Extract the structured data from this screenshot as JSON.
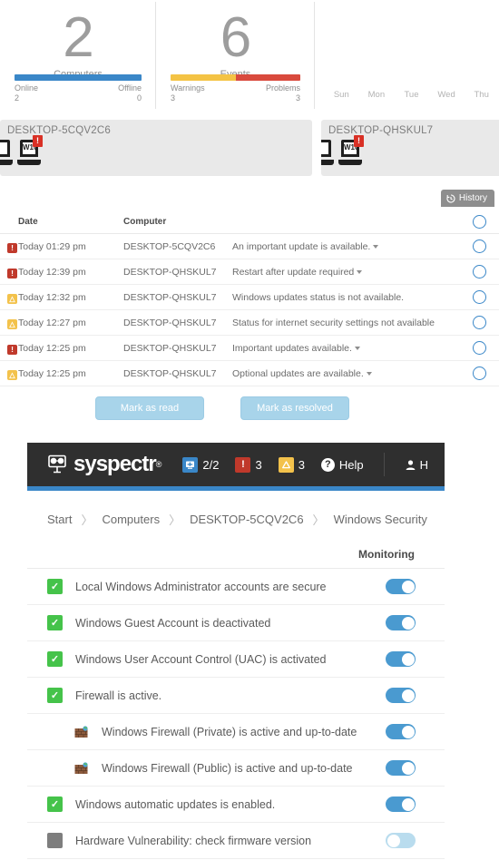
{
  "dashboard": {
    "computers": {
      "value": "2",
      "label": "Computers",
      "online_label": "Online",
      "online_value": "2",
      "offline_label": "Offline",
      "offline_value": "0",
      "bar_color": "#3a87c8"
    },
    "events": {
      "value": "6",
      "label": "Events",
      "warnings_label": "Warnings",
      "warnings_value": "3",
      "problems_label": "Problems",
      "problems_value": "3",
      "warning_color": "#f4c344",
      "problem_color": "#d94a3d"
    },
    "week": {
      "days": [
        "Sun",
        "Mon",
        "Tue",
        "Wed",
        "Thu"
      ]
    }
  },
  "computer_cards": [
    {
      "title": "DESKTOP-5CQV2C6",
      "badge": "!",
      "glyph": "W10"
    },
    {
      "title": "DESKTOP-QHSKUL7",
      "badge": "!",
      "glyph": "W10"
    }
  ],
  "history_button": {
    "label": "History",
    "icon": "clock-history-icon"
  },
  "events_table": {
    "columns": {
      "date": "Date",
      "computer": "Computer"
    },
    "rows": [
      {
        "severity": "error",
        "date": "Today 01:29 pm",
        "computer": "DESKTOP-5CQV2C6",
        "message": "An important update is available.",
        "has_caret": true
      },
      {
        "severity": "error",
        "date": "Today 12:39 pm",
        "computer": "DESKTOP-QHSKUL7",
        "message": "Restart after update required",
        "has_caret": true
      },
      {
        "severity": "warning",
        "date": "Today 12:32 pm",
        "computer": "DESKTOP-QHSKUL7",
        "message": "Windows updates status is not available.",
        "has_caret": false
      },
      {
        "severity": "warning",
        "date": "Today 12:27 pm",
        "computer": "DESKTOP-QHSKUL7",
        "message": "Status for internet security settings not available",
        "has_caret": false
      },
      {
        "severity": "error",
        "date": "Today 12:25 pm",
        "computer": "DESKTOP-QHSKUL7",
        "message": "Important updates available.",
        "has_caret": true
      },
      {
        "severity": "warning",
        "date": "Today 12:25 pm",
        "computer": "DESKTOP-QHSKUL7",
        "message": "Optional updates are available.",
        "has_caret": true
      }
    ]
  },
  "actions": {
    "mark_read": "Mark as read",
    "mark_resolved": "Mark as resolved"
  },
  "panel": {
    "navbar": {
      "brand": "syspectr",
      "brand_mark": "monitor-glasses-logo-icon",
      "registered": "®",
      "stats": [
        {
          "icon": "computers-icon",
          "color": "#3a87c8",
          "glyph": "❖",
          "value": "2/2"
        },
        {
          "icon": "problems-icon",
          "color": "#c0392b",
          "glyph": "!",
          "value": "3"
        },
        {
          "icon": "warnings-icon",
          "color": "#f3c24b",
          "glyph": "△",
          "value": "3"
        }
      ],
      "help_label": "Help",
      "help_icon": "question-circle-icon",
      "user_label": "H",
      "user_icon": "user-icon",
      "accent_color": "#3a87c8"
    },
    "breadcrumb": [
      "Start",
      "Computers",
      "DESKTOP-5CQV2C6",
      "Windows Security"
    ],
    "breadcrumb_separator": "〉",
    "monitoring_header": "Monitoring",
    "checks": [
      {
        "state": "ok",
        "icon": "check-icon",
        "label": "Local Windows Administrator accounts are secure",
        "toggle": "on",
        "sub": false
      },
      {
        "state": "ok",
        "icon": "check-icon",
        "label": "Windows Guest Account is deactivated",
        "toggle": "on",
        "sub": false
      },
      {
        "state": "ok",
        "icon": "check-icon",
        "label": "Windows User Account Control (UAC) is activated",
        "toggle": "on",
        "sub": false
      },
      {
        "state": "ok",
        "icon": "check-icon",
        "label": "Firewall is active.",
        "toggle": "on",
        "sub": false
      },
      {
        "state": "firewall",
        "icon": "firewall-brick-icon",
        "label": "Windows Firewall (Private) is active and up-to-date",
        "toggle": "on",
        "sub": true
      },
      {
        "state": "firewall",
        "icon": "firewall-brick-icon",
        "label": "Windows Firewall (Public) is active and up-to-date",
        "toggle": "on",
        "sub": true
      },
      {
        "state": "ok",
        "icon": "check-icon",
        "label": "Windows automatic updates is enabled.",
        "toggle": "on",
        "sub": false
      },
      {
        "state": "disabled",
        "icon": "disabled-box-icon",
        "label": "Hardware Vulnerability: check firmware version",
        "toggle": "off",
        "sub": false
      }
    ]
  }
}
